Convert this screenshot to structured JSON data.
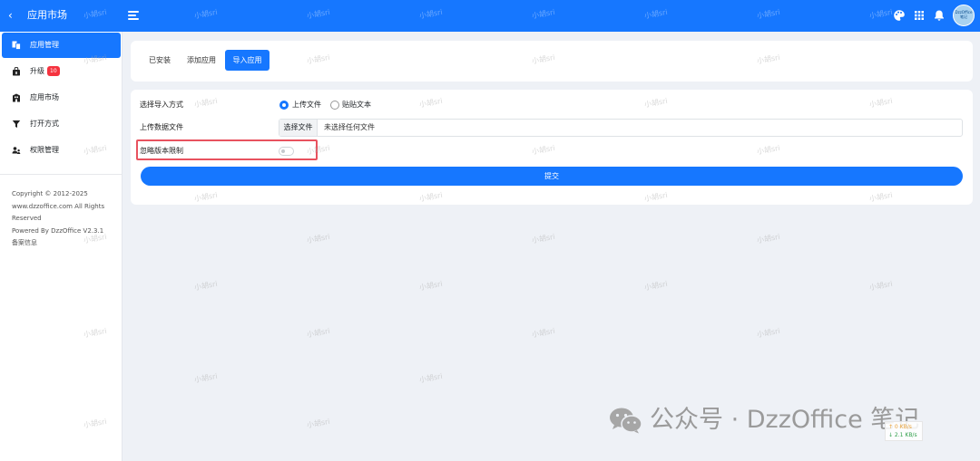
{
  "header": {
    "back_glyph": "‹",
    "title": "应用市场",
    "icons": [
      "menu-icon",
      "palette-icon",
      "apps-grid-icon",
      "bell-icon"
    ],
    "avatar_text": "DzzOffice 笔记",
    "brand_color": "#1677ff"
  },
  "sidebar": {
    "items": [
      {
        "label": "应用管理",
        "icon": "app-manage-icon",
        "active": true
      },
      {
        "label": "升级",
        "icon": "upgrade-bag-icon",
        "badge": "10"
      },
      {
        "label": "应用市场",
        "icon": "market-store-icon"
      },
      {
        "label": "打开方式",
        "icon": "filter-icon"
      },
      {
        "label": "权限管理",
        "icon": "users-permission-icon"
      }
    ],
    "copyright": {
      "line1": "Copyright © 2012-2025",
      "line2": "www.dzzoffice.com All Rights",
      "line3": "Reserved",
      "line4": "Powered By DzzOffice V2.3.1",
      "line5": "备案信息"
    }
  },
  "tabs": {
    "installed": "已安装",
    "add": "添加应用",
    "import": "导入应用",
    "active_tab": "导入应用"
  },
  "form": {
    "import_method_label": "选择导入方式",
    "option_upload": "上传文件",
    "option_paste": "贴贴文本",
    "selected_option": "上传文件",
    "upload_label": "上传数据文件",
    "file_button": "选择文件",
    "file_status": "未选择任何文件",
    "ignore_version_label": "忽略版本限制",
    "ignore_version_on": false,
    "submit_label": "提交",
    "highlight_color": "#e8525f"
  },
  "watermark": {
    "text": "小胡sri"
  },
  "footer": {
    "wechat_icon": "wechat-icon",
    "text": "公众号 · DzzOffice 笔记"
  },
  "speed": {
    "up": "↑ 0 KB/s",
    "down": "↓ 2.1 KB/s"
  }
}
